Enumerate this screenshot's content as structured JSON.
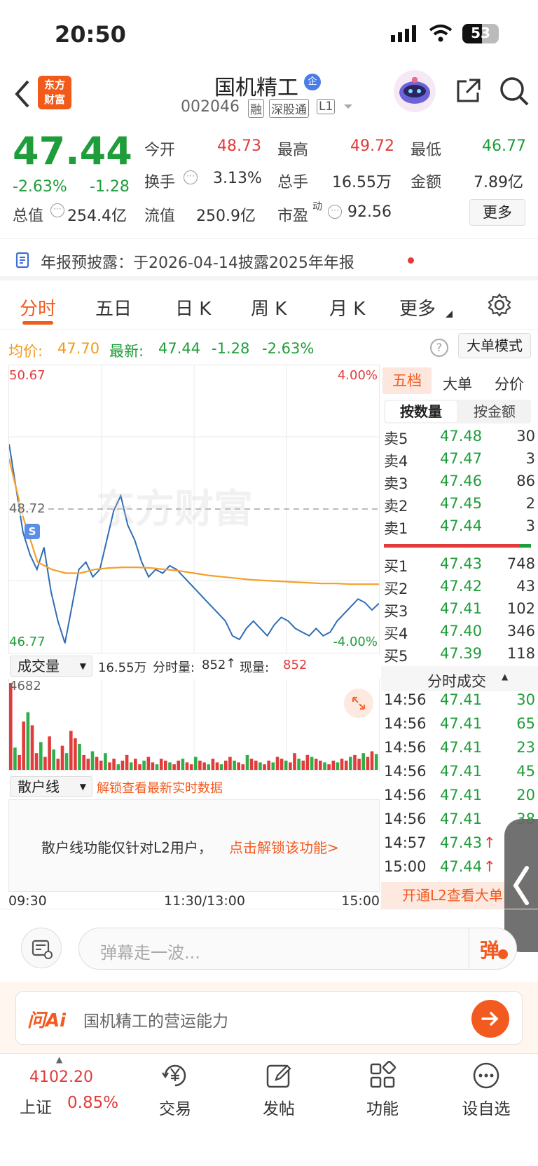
{
  "status": {
    "time": "20:50",
    "battery": "53"
  },
  "header": {
    "logo_line1": "东方",
    "logo_line2": "财富",
    "stock_name": "国机精工",
    "badge": "企",
    "stock_code": "002046",
    "tags": [
      "融",
      "深股通",
      "L1"
    ]
  },
  "quote": {
    "price": "47.44",
    "change_pct": "-2.63%",
    "change": "-1.28",
    "fields": [
      {
        "label": "今开",
        "value": "48.73"
      },
      {
        "label": "最高",
        "value": "49.72"
      },
      {
        "label": "最低",
        "value": "46.77"
      },
      {
        "label": "换手",
        "value": "3.13%"
      },
      {
        "label": "总手",
        "value": "16.55万"
      },
      {
        "label": "金额",
        "value": "7.89亿"
      },
      {
        "label": "总值",
        "value": "254.4亿"
      },
      {
        "label": "流值",
        "value": "250.9亿"
      },
      {
        "label": "市盈",
        "sup": "动",
        "value": "92.56"
      }
    ],
    "more_button": "更多"
  },
  "notice": {
    "text": "年报预披露：于2026-04-14披露2025年年报"
  },
  "tabs": [
    "分时",
    "五日",
    "日 K",
    "周 K",
    "月 K",
    "更多"
  ],
  "avg_line": {
    "avg_label": "均价:",
    "avg_value": "47.70",
    "latest_label": "最新:",
    "latest_value": "47.44",
    "change": "-1.28",
    "change_pct": "-2.63%",
    "mode_button": "大单模式"
  },
  "chart_data": {
    "type": "line",
    "title": "",
    "y_top": "50.67",
    "y_bottom": "46.77",
    "y_ref": "48.72",
    "pct_top": "4.00%",
    "pct_bottom": "-4.00%",
    "ylim": [
      46.77,
      50.67
    ],
    "x_labels": [
      "09:30",
      "11:30/13:00",
      "15:00"
    ],
    "series": [
      {
        "values": [
          49.6,
          49.0,
          48.4,
          48.1,
          47.9,
          48.2,
          47.6,
          47.2,
          46.9,
          47.4,
          47.9,
          48.0,
          47.8,
          47.9,
          48.3,
          48.7,
          48.9,
          48.5,
          48.3,
          48.0,
          47.8,
          47.9,
          47.85,
          47.95,
          47.9,
          47.8,
          47.7,
          47.6,
          47.5,
          47.4,
          47.3,
          47.2,
          47.0,
          46.95,
          47.1,
          47.2,
          47.1,
          47.0,
          47.15,
          47.25,
          47.2,
          47.1,
          47.05,
          47.0,
          47.1,
          47.0,
          47.05,
          47.2,
          47.3,
          47.4,
          47.5,
          47.45,
          47.35,
          47.44
        ]
      },
      {
        "values": [
          49.4,
          48.6,
          48.0,
          47.9,
          47.85,
          47.85,
          47.9,
          47.92,
          47.93,
          47.93,
          47.92,
          47.9,
          47.88,
          47.85,
          47.82,
          47.8,
          47.78,
          47.76,
          47.75,
          47.74,
          47.73,
          47.72,
          47.71,
          47.71,
          47.7,
          47.7,
          47.7
        ]
      }
    ],
    "watermark": "东方财富",
    "marker": "S"
  },
  "volume": {
    "selector": "成交量",
    "total": "16.55万",
    "period_label": "分时量:",
    "period_value": "852",
    "now_label": "现量:",
    "now_value": "852",
    "max": "4682",
    "values": [
      4682,
      1200,
      800,
      2600,
      3100,
      2400,
      900,
      1500,
      700,
      1800,
      1100,
      600,
      1300,
      900,
      2100,
      1700,
      1400,
      800,
      600,
      1000,
      700,
      500,
      900,
      400,
      600,
      300,
      500,
      800,
      400,
      600,
      300,
      500,
      700,
      400,
      300,
      600,
      500,
      400,
      300,
      500,
      600,
      400,
      300,
      700,
      500,
      400,
      300,
      600,
      400,
      300,
      500,
      700,
      500,
      400,
      300,
      800,
      600,
      500,
      400,
      300,
      500,
      400,
      700,
      600,
      500,
      400,
      900,
      600,
      500,
      800,
      700,
      600,
      500,
      400,
      300,
      500,
      400,
      600,
      500,
      700,
      800,
      600,
      900,
      700,
      1000,
      852
    ]
  },
  "retail": {
    "selector": "散户线",
    "unlock_text": "解锁查看最新实时数据",
    "info_text": "散户线功能仅针对L2用户，",
    "info_link": "点击解锁该功能>"
  },
  "book": {
    "tabs": [
      "五档",
      "大单",
      "分价"
    ],
    "sub_tabs": [
      "按数量",
      "按金额"
    ],
    "asks": [
      {
        "label": "卖5",
        "price": "47.48",
        "qty": "30"
      },
      {
        "label": "卖4",
        "price": "47.47",
        "qty": "3"
      },
      {
        "label": "卖3",
        "price": "47.46",
        "qty": "86"
      },
      {
        "label": "卖2",
        "price": "47.45",
        "qty": "2"
      },
      {
        "label": "卖1",
        "price": "47.44",
        "qty": "3"
      }
    ],
    "bids": [
      {
        "label": "买1",
        "price": "47.43",
        "qty": "748"
      },
      {
        "label": "买2",
        "price": "47.42",
        "qty": "43"
      },
      {
        "label": "买3",
        "price": "47.41",
        "qty": "102"
      },
      {
        "label": "买4",
        "price": "47.40",
        "qty": "346"
      },
      {
        "label": "买5",
        "price": "47.39",
        "qty": "118"
      }
    ],
    "trades_title": "分时成交",
    "trades": [
      {
        "time": "14:56",
        "price": "47.41",
        "vol": "30"
      },
      {
        "time": "14:56",
        "price": "47.41",
        "vol": "65"
      },
      {
        "time": "14:56",
        "price": "47.41",
        "vol": "23"
      },
      {
        "time": "14:56",
        "price": "47.41",
        "vol": "45"
      },
      {
        "time": "14:56",
        "price": "47.41",
        "vol": "20"
      },
      {
        "time": "14:56",
        "price": "47.41",
        "vol": "38"
      },
      {
        "time": "14:57",
        "price": "47.43",
        "vol": ""
      },
      {
        "time": "15:00",
        "price": "47.44",
        "vol": ""
      }
    ],
    "l2_button": "开通L2查看大单"
  },
  "danmu": {
    "placeholder": "弹幕走一波...",
    "send_label": "弹"
  },
  "ai": {
    "logo": "问Ai",
    "prompt": "国机精工的营运能力"
  },
  "bottomnav": {
    "index_value": "4102.20",
    "index_name": "上证",
    "index_pct": "0.85%",
    "items": [
      "交易",
      "发帖",
      "功能",
      "设自选"
    ]
  }
}
